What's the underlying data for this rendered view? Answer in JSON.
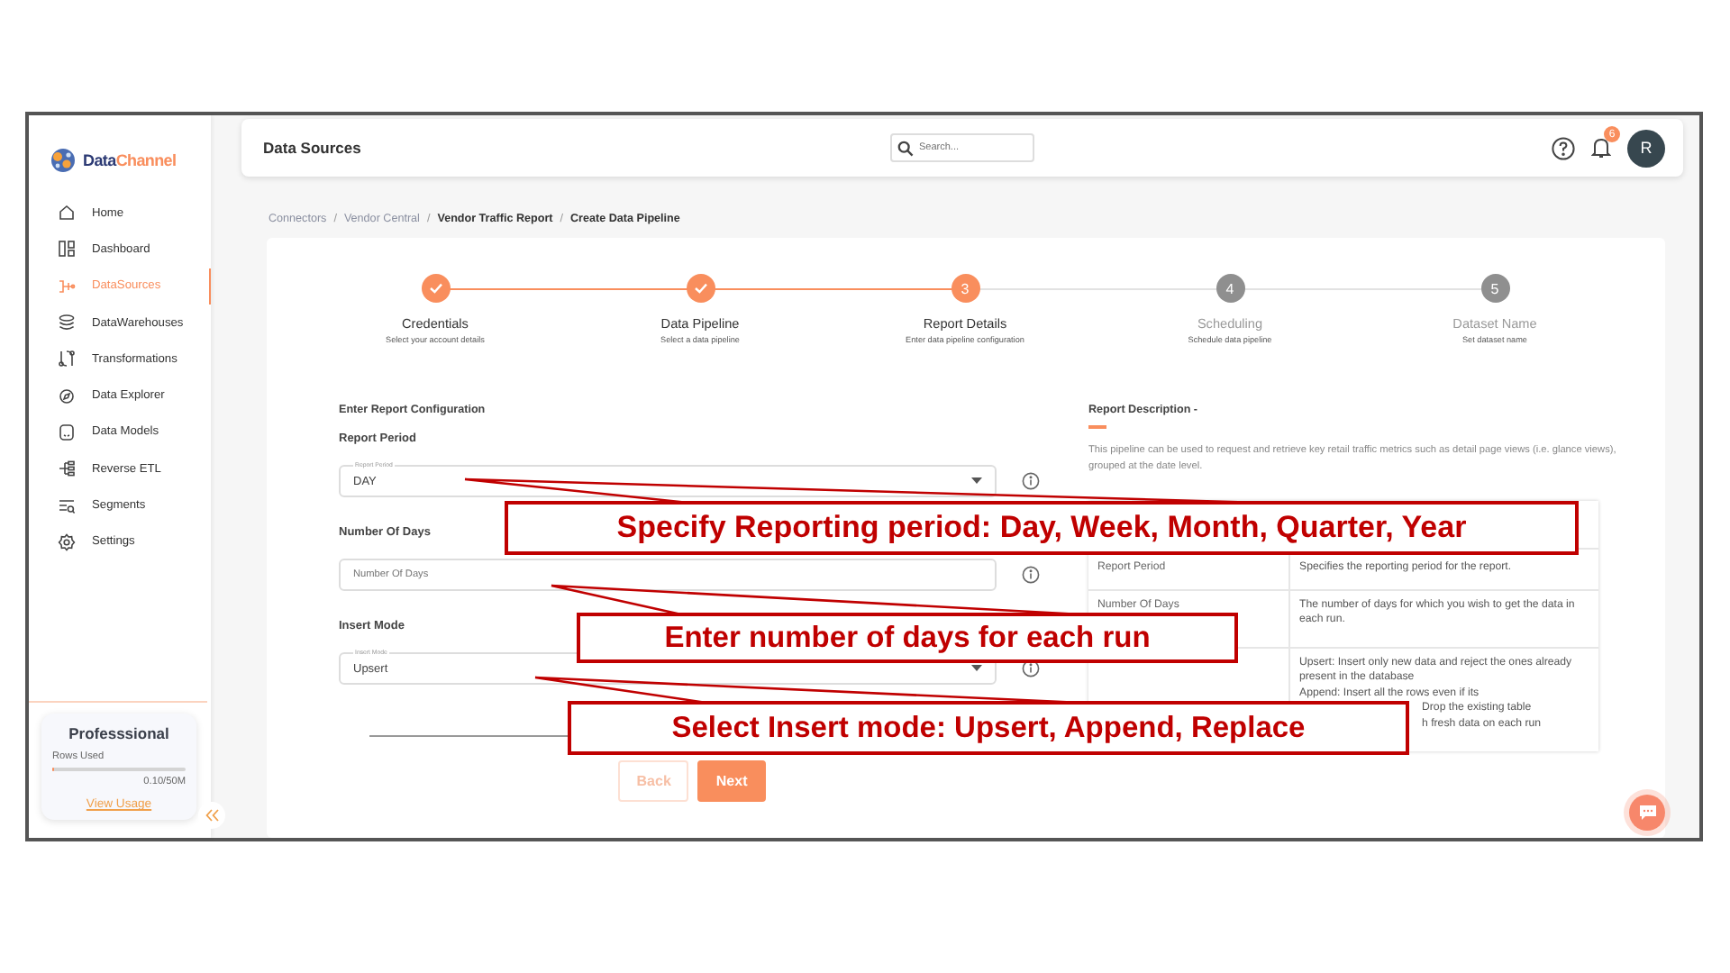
{
  "brand": {
    "part_1": "Data",
    "part_2": "Channel"
  },
  "sidebar": {
    "items": [
      {
        "label": "Home",
        "selected": false
      },
      {
        "label": "Dashboard",
        "selected": false
      },
      {
        "label": "DataSources",
        "selected": true
      },
      {
        "label": "DataWarehouses",
        "selected": false
      },
      {
        "label": "Transformations",
        "selected": false
      },
      {
        "label": "Data Explorer",
        "selected": false
      },
      {
        "label": "Data Models",
        "selected": false
      },
      {
        "label": "Reverse ETL",
        "selected": false
      },
      {
        "label": "Segments",
        "selected": false
      },
      {
        "label": "Settings",
        "selected": false
      }
    ],
    "plan": {
      "name": "Professsional",
      "rows_label": "Rows Used",
      "level": 0.002,
      "reading": "0.10/50M",
      "link": "View Usage"
    }
  },
  "header": {
    "title": "Data Sources",
    "search": {
      "placeholder": "Search..."
    },
    "notifications": "6",
    "avatar": "R"
  },
  "breadcrumb": [
    {
      "label": "Connectors",
      "current": false
    },
    {
      "separator": "/",
      "label": "Vendor Central",
      "current": false
    },
    {
      "separator": "/",
      "label": "Vendor Traffic Report",
      "current": true
    },
    {
      "separator": "/",
      "label": "Create Data Pipeline",
      "current": true
    }
  ],
  "steps": [
    {
      "title": "Credentials",
      "subtitle": "Select your account details",
      "completed": true,
      "current": false
    },
    {
      "title": "Data Pipeline",
      "subtitle": "Select a data pipeline",
      "completed": true,
      "current": false
    },
    {
      "title": "Report Details",
      "subtitle": "Enter data pipeline configuration",
      "completed": false,
      "current": true,
      "number": "3"
    },
    {
      "title": "Scheduling",
      "subtitle": "Schedule data pipeline",
      "completed": false,
      "current": false,
      "number": "4"
    },
    {
      "title": "Dataset Name",
      "subtitle": "Set dataset name",
      "completed": false,
      "current": false,
      "number": "5"
    }
  ],
  "form": {
    "heading": "Enter Report Configuration",
    "fields": [
      {
        "label": "Report Period",
        "kind": "select",
        "floating_label": "Report Period",
        "value": "DAY"
      },
      {
        "label": "Number Of Days",
        "kind": "input",
        "placeholder": "Number Of Days"
      },
      {
        "label": "Insert Mode",
        "kind": "select",
        "floating_label": "Insert Mode",
        "value": "Upsert"
      }
    ],
    "buttons": [
      {
        "label": "Back",
        "disabled": true
      },
      {
        "label": "Next",
        "disabled": false
      }
    ]
  },
  "description": {
    "heading": "Report Description -",
    "text": "This pipeline can be used to request and retrieve key retail traffic metrics such as detail page views (i.e. glance views), grouped at the date level.",
    "rows": [
      {
        "name": "Report Period",
        "lines": [
          "Specifies the reporting period for the report."
        ]
      },
      {
        "name": "Number Of Days",
        "lines": [
          "The number of days for which you wish to get the data in each run."
        ]
      },
      {
        "lines": [
          "Upsert: Insert only new data and reject the ones already present in the database",
          "Append: Insert all the rows even if its"
        ],
        "tail": [
          "Drop the existing table",
          "h fresh data on each run"
        ]
      }
    ]
  },
  "annotations": [
    {
      "text": "Specify Reporting period: Day, Week, Month, Quarter, Year"
    },
    {
      "text": "Enter number of days for each run"
    },
    {
      "text": "Select Insert mode: Upsert, Append, Replace"
    }
  ]
}
